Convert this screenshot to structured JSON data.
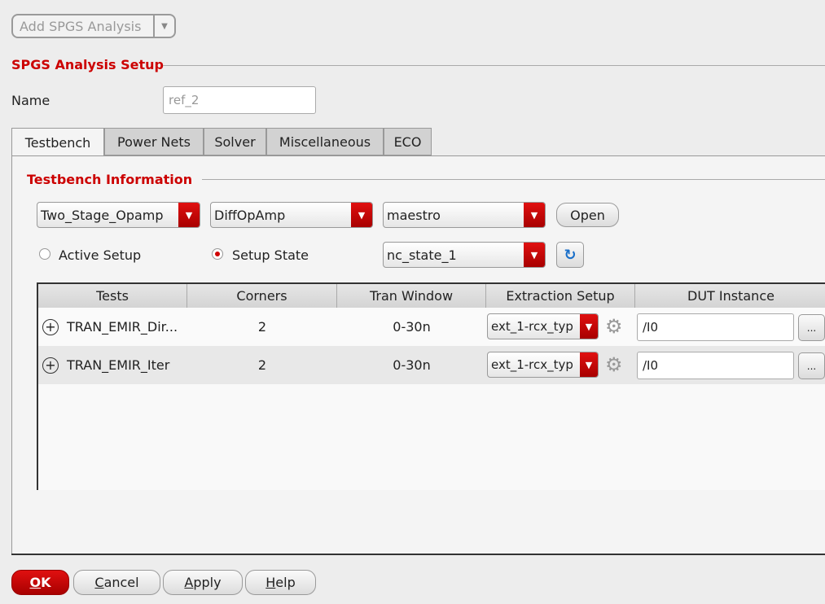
{
  "toolbar": {
    "add_analysis": "Add SPGS Analysis"
  },
  "setup": {
    "title": "SPGS Analysis Setup",
    "name_label": "Name",
    "name_value": "ref_2"
  },
  "tabs": [
    "Testbench",
    "Power Nets",
    "Solver",
    "Miscellaneous",
    "ECO"
  ],
  "testbench": {
    "title": "Testbench Information",
    "library": "Two_Stage_Opamp",
    "cell": "DiffOpAmp",
    "view": "maestro",
    "open_label": "Open",
    "active_setup_label": "Active Setup",
    "setup_state_label": "Setup State",
    "setup_state_selected": true,
    "state_value": "nc_state_1"
  },
  "table": {
    "headers": [
      "Tests",
      "Corners",
      "Tran Window",
      "Extraction Setup",
      "DUT Instance"
    ],
    "rows": [
      {
        "test": "TRAN_EMIR_Dir...",
        "corners": "2",
        "tran": "0-30n",
        "extraction": "ext_1-rcx_typ",
        "dut": "/I0",
        "browse": "..."
      },
      {
        "test": "TRAN_EMIR_Iter",
        "corners": "2",
        "tran": "0-30n",
        "extraction": "ext_1-rcx_typ",
        "dut": "/I0",
        "browse": "..."
      }
    ]
  },
  "buttons": {
    "ok_u": "O",
    "ok_rest": "K",
    "cancel_u": "C",
    "cancel_rest": "ancel",
    "apply_u": "A",
    "apply_rest": "pply",
    "help_u": "H",
    "help_rest": "elp"
  },
  "colors": {
    "accent": "#cc0000"
  }
}
